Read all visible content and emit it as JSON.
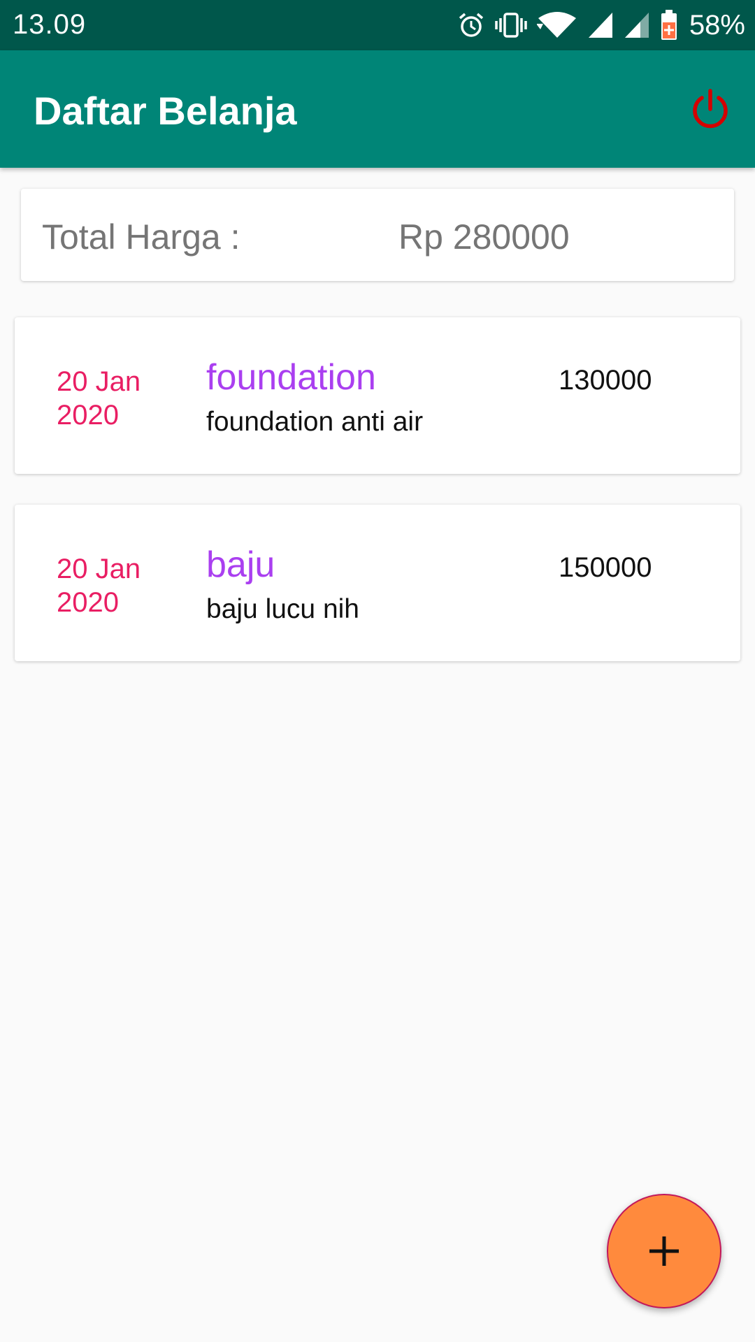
{
  "status_bar": {
    "time": "13.09",
    "battery_percent": "58%",
    "icons": [
      "alarm-icon",
      "vibrate-icon",
      "wifi-icon",
      "signal-icon",
      "signal-icon-2",
      "battery-icon"
    ]
  },
  "app_bar": {
    "title": "Daftar Belanja",
    "power_icon": "power-icon",
    "background_color": "#008577",
    "power_color": "#d50000"
  },
  "total": {
    "label": "Total Harga :",
    "value": "Rp 280000"
  },
  "items": [
    {
      "date_line1": "20 Jan",
      "date_line2": "2020",
      "name": "foundation",
      "description": "foundation anti air",
      "price": "130000"
    },
    {
      "date_line1": "20 Jan",
      "date_line2": "2020",
      "name": "baju",
      "description": "baju lucu nih",
      "price": "150000"
    }
  ],
  "fab": {
    "icon": "plus-icon",
    "color": "#ff8a3d"
  },
  "colors": {
    "date": "#e91e63",
    "item_name": "#aa3ff0",
    "status_bar": "#00574b"
  }
}
